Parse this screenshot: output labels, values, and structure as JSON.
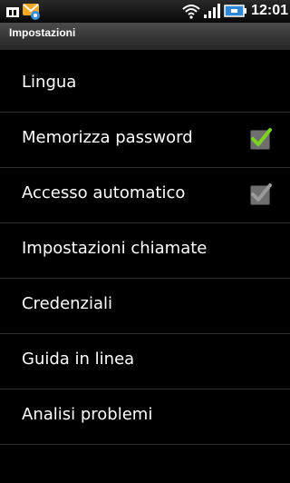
{
  "status_bar": {
    "time": "12:01",
    "left_icons": [
      "sim-card-icon",
      "messenger-notification-icon"
    ],
    "right_icons": [
      "wifi-icon",
      "signal-icon",
      "battery-icon"
    ]
  },
  "title_bar": {
    "title": "Impostazioni"
  },
  "settings": {
    "items": [
      {
        "label": "Lingua"
      },
      {
        "label": "Memorizza password",
        "checkbox": true,
        "checked": true,
        "enabled": true
      },
      {
        "label": "Accesso automatico",
        "checkbox": true,
        "checked": true,
        "enabled": false
      },
      {
        "label": "Impostazioni chiamate"
      },
      {
        "label": "Credenziali"
      },
      {
        "label": "Guida in linea"
      },
      {
        "label": "Analisi problemi"
      }
    ]
  },
  "colors": {
    "check_enabled": "#7ed321",
    "check_disabled": "#9a9a9a",
    "background": "#000000"
  }
}
